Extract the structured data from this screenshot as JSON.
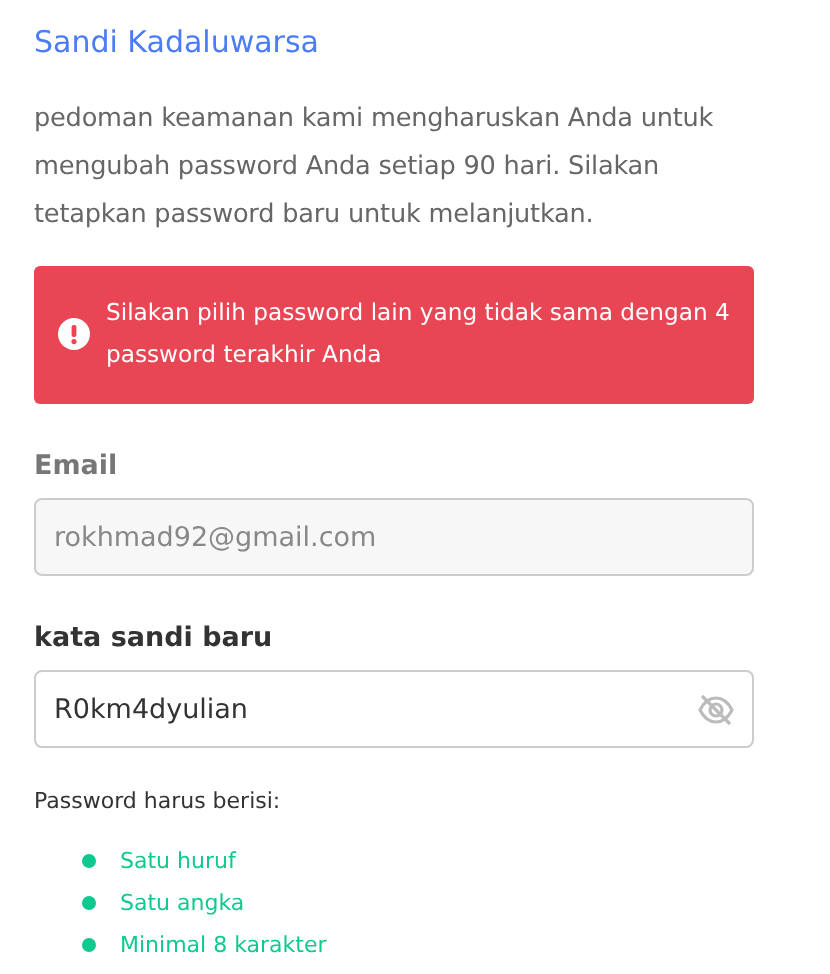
{
  "title": "Sandi Kadaluwarsa",
  "description": "pedoman keamanan kami mengharuskan Anda untuk mengubah password Anda setiap 90 hari. Silakan tetapkan password baru untuk melanjutkan.",
  "alert": {
    "message": "Silakan pilih password lain yang tidak sama dengan 4 password terakhir Anda"
  },
  "fields": [
    {
      "label": "Email",
      "value": "rokhmad92@gmail.com",
      "disabled": true,
      "kind": "text"
    },
    {
      "label": "kata sandi baru",
      "value": "R0km4dyulian",
      "disabled": false,
      "kind": "password"
    }
  ],
  "requirements": {
    "heading": "Password harus berisi:",
    "items": [
      {
        "label": "Satu huruf",
        "met": true
      },
      {
        "label": "Satu angka",
        "met": true
      },
      {
        "label": "Minimal 8 karakter",
        "met": true
      }
    ]
  }
}
